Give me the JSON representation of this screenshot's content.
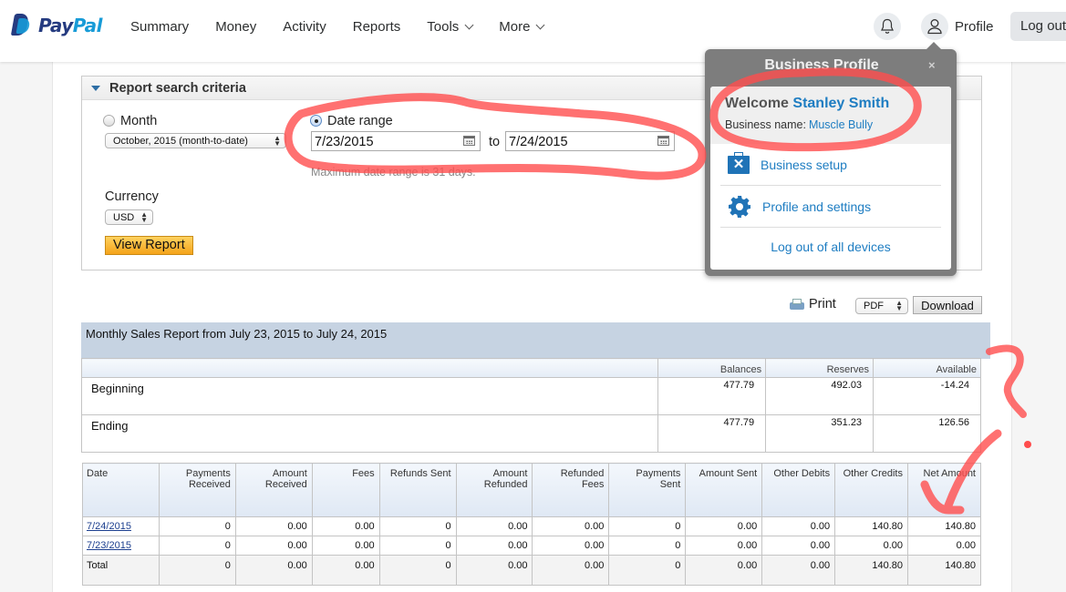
{
  "brand": {
    "pay": "Pay",
    "pal": "Pal"
  },
  "nav": {
    "items": [
      {
        "label": "Summary"
      },
      {
        "label": "Money"
      },
      {
        "label": "Activity"
      },
      {
        "label": "Reports"
      },
      {
        "label": "Tools",
        "dropdown": true
      },
      {
        "label": "More",
        "dropdown": true
      }
    ],
    "profile_label": "Profile",
    "logout_label": "Log out"
  },
  "criteria": {
    "title": "Report search criteria",
    "month_label": "Month",
    "month_selected": false,
    "month_value": "October, 2015 (month-to-date)",
    "date_range_label": "Date range",
    "date_range_selected": true,
    "from_date": "7/23/2015",
    "to_label": "to",
    "to_date": "7/24/2015",
    "hint": "Maximum date range is 31 days.",
    "currency_label": "Currency",
    "currency_value": "USD",
    "view_button": "View Report"
  },
  "export": {
    "print_label": "Print",
    "format_value": "PDF",
    "download_label": "Download"
  },
  "report": {
    "title": "Monthly Sales Report from July 23, 2015 to July 24, 2015",
    "balance_headers": [
      "Balances",
      "Reserves",
      "Available"
    ],
    "balance_rows": [
      {
        "label": "Beginning",
        "values": [
          "477.79",
          "492.03",
          "-14.24"
        ]
      },
      {
        "label": "Ending",
        "values": [
          "477.79",
          "351.23",
          "126.56"
        ]
      }
    ],
    "activity_headers": [
      "Date",
      "Payments Received",
      "Amount Received",
      "Fees",
      "Refunds Sent",
      "Amount Refunded",
      "Refunded Fees",
      "Payments Sent",
      "Amount Sent",
      "Other Debits",
      "Other Credits",
      "Net Amount"
    ],
    "activity_rows": [
      [
        "7/24/2015",
        "0",
        "0.00",
        "0.00",
        "0",
        "0.00",
        "0.00",
        "0",
        "0.00",
        "0.00",
        "140.80",
        "140.80"
      ],
      [
        "7/23/2015",
        "0",
        "0.00",
        "0.00",
        "0",
        "0.00",
        "0.00",
        "0",
        "0.00",
        "0.00",
        "0.00",
        "0.00"
      ],
      [
        "Total",
        "0",
        "0.00",
        "0.00",
        "0",
        "0.00",
        "0.00",
        "0",
        "0.00",
        "0.00",
        "140.80",
        "140.80"
      ]
    ]
  },
  "popup": {
    "title": "Business Profile",
    "close": "×",
    "welcome_prefix": "Welcome",
    "user_name": "Stanley Smith",
    "business_name_label": "Business name:",
    "business_name": "Muscle Bully",
    "items": [
      {
        "label": "Business setup",
        "icon": "business-setup-icon"
      },
      {
        "label": "Profile and settings",
        "icon": "gear-icon"
      }
    ],
    "logout_all": "Log out of all devices"
  },
  "colors": {
    "brand_dark": "#253b80",
    "brand_light": "#179bd7",
    "link_blue": "#1e7dc2",
    "annotation_red": "#ff4d4d",
    "view_button": "#f4a31a",
    "report_header": "#c6d3e2"
  }
}
